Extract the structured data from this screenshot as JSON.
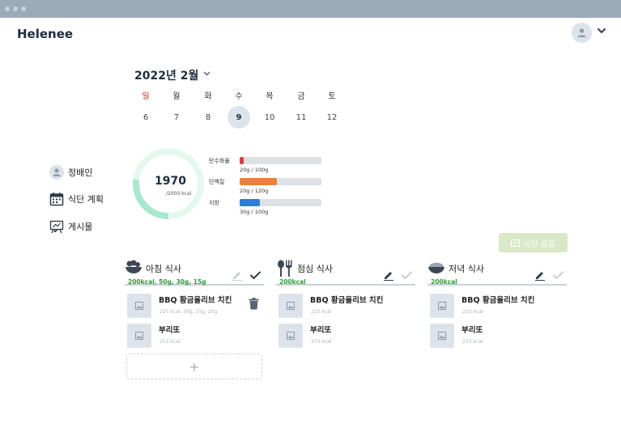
{
  "app": {
    "brand": "Helenee"
  },
  "calendar": {
    "month_label": "2022년 2월",
    "weekdays": [
      "일",
      "월",
      "화",
      "수",
      "목",
      "금",
      "토"
    ],
    "days": [
      "6",
      "7",
      "8",
      "9",
      "10",
      "11",
      "12"
    ],
    "selected_day": "9"
  },
  "sidebar": {
    "items": [
      {
        "label": "정배인",
        "icon": "user-icon"
      },
      {
        "label": "식단 계획",
        "icon": "calendar-icon"
      },
      {
        "label": "게시물",
        "icon": "board-icon"
      }
    ]
  },
  "summary": {
    "calories": "1970",
    "calories_goal": "/2000 kcal",
    "calories_fraction": 0.985,
    "macros": [
      {
        "label": "탄수화물",
        "value": "20g / 100g",
        "fraction": 0.05,
        "color": "#d8404a"
      },
      {
        "label": "단백질",
        "value": "20g / 120g",
        "fraction": 0.46,
        "color": "#e8823a"
      },
      {
        "label": "지방",
        "value": "30g / 100g",
        "fraction": 0.25,
        "color": "#2f7fd1"
      }
    ],
    "colors": {
      "ring": "#a8e8cc",
      "ring_track": "#e4f8ef"
    }
  },
  "share_button": {
    "label": "식단 공유"
  },
  "meals": [
    {
      "title": "아침 식사",
      "summary": "200kcal, 50g, 30g, 15g",
      "icon": "salad-bowl-icon",
      "foods": [
        {
          "name": "BBQ 황금올리브 치킨",
          "info": "225 kcal, 30g, 15g, 20g"
        },
        {
          "name": "부리또",
          "info": "253 kcal"
        }
      ],
      "add_label": "+"
    },
    {
      "title": "점심 식사",
      "summary": "200kcal",
      "icon": "fork-spoon-icon",
      "foods": [
        {
          "name": "BBQ 황금올리브 치킨",
          "info": "225 kcal"
        },
        {
          "name": "부리또",
          "info": "253 kcal"
        }
      ]
    },
    {
      "title": "저녁 식사",
      "summary": "200kcal",
      "icon": "rice-bowl-icon",
      "foods": [
        {
          "name": "BBQ 황금올리브 치킨",
          "info": "225 kcal"
        },
        {
          "name": "부리또",
          "info": "253 kcal"
        }
      ]
    }
  ]
}
